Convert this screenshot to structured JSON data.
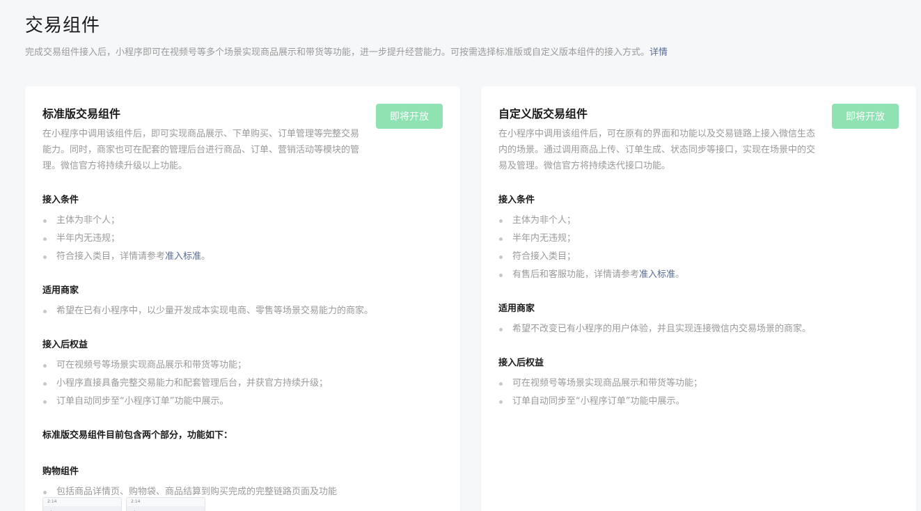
{
  "header": {
    "title": "交易组件",
    "description": "完成交易组件接入后，小程序即可在视频号等多个场景实现商品展示和带货等功能，进一步提升经营能力。可按需选择标准版或自定义版本组件的接入方式。",
    "detail_link": "详情"
  },
  "colors": {
    "accent": "#8fe3b3",
    "link": "#576b95"
  },
  "cards": [
    {
      "title": "标准版交易组件",
      "button": "即将开放",
      "description": "在小程序中调用该组件后，即可实现商品展示、下单购买、订单管理等完整交易能力。同时，商家也可在配套的管理后台进行商品、订单、营销活动等模块的管理。微信官方将持续升级以上功能。",
      "conditions": {
        "title": "接入条件",
        "items": [
          "主体为非个人；",
          "半年内无违规；"
        ],
        "last_prefix": "符合接入类目，详情请参考",
        "last_link": "准入标准",
        "last_suffix": "。"
      },
      "merchants": {
        "title": "适用商家",
        "items": [
          "希望在已有小程序中，以少量开发成本实现电商、零售等场景交易能力的商家。"
        ]
      },
      "benefits": {
        "title": "接入后权益",
        "items": [
          "可在视频号等场景实现商品展示和带货等功能；",
          "小程序直接具备完整交易能力和配套管理后台，并获官方持续升级；",
          "订单自动同步至“小程序订单”功能中展示。"
        ]
      },
      "parts_note": "标准版交易组件目前包含两个部分，功能如下：",
      "shopping": {
        "title": "购物组件",
        "items": [
          "包括商品详情页、购物袋、商品结算到购买完成的完整链路页面及功能"
        ]
      },
      "thumbs": [
        {
          "time": "2:14",
          "caption": "<"
        },
        {
          "time": "2:14",
          "caption": "<"
        }
      ]
    },
    {
      "title": "自定义版交易组件",
      "button": "即将开放",
      "description": "在小程序中调用该组件后，可在原有的界面和功能以及交易链路上接入微信生态内的场景。通过调用商品上传、订单生成、状态同步等接口，实现在场景中的交易及管理。微信官方将持续迭代接口功能。",
      "conditions": {
        "title": "接入条件",
        "items": [
          "主体为非个人；",
          "半年内无违规；",
          "符合接入类目；"
        ],
        "last_prefix": "有售后和客服功能，详情请参考",
        "last_link": "准入标准",
        "last_suffix": "。"
      },
      "merchants": {
        "title": "适用商家",
        "items": [
          "希望不改变已有小程序的用户体验，并且实现连接微信内交易场景的商家。"
        ]
      },
      "benefits": {
        "title": "接入后权益",
        "items": [
          "可在视频号等场景实现商品展示和带货等功能；",
          "订单自动同步至“小程序订单”功能中展示。"
        ]
      }
    }
  ]
}
